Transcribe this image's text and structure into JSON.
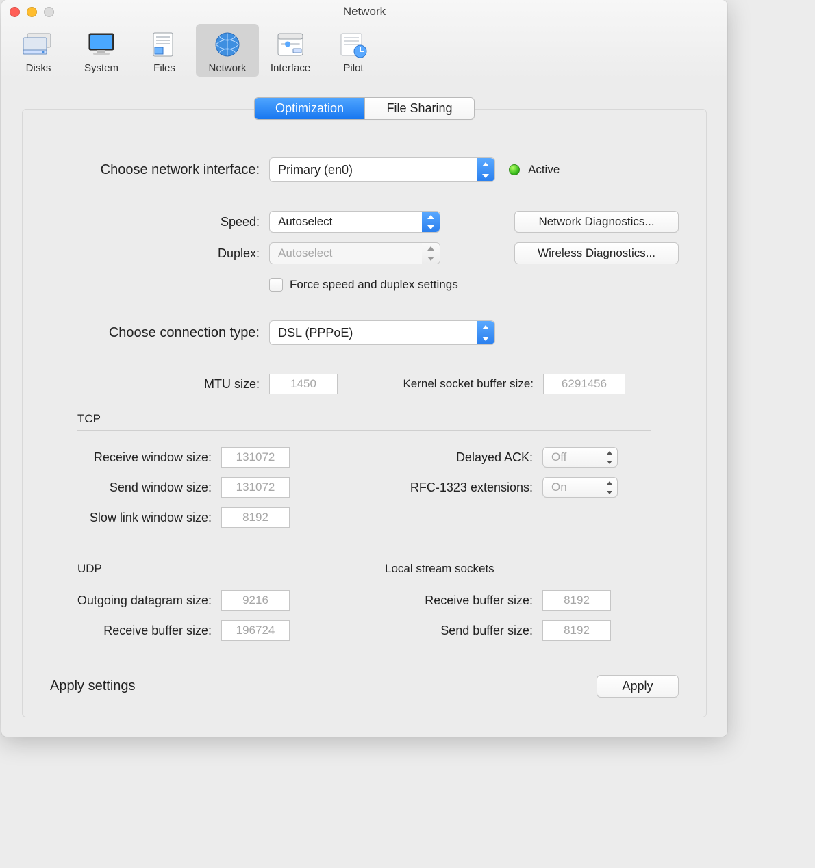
{
  "window": {
    "title": "Network"
  },
  "toolbar": {
    "items": [
      {
        "label": "Disks"
      },
      {
        "label": "System"
      },
      {
        "label": "Files"
      },
      {
        "label": "Network"
      },
      {
        "label": "Interface"
      },
      {
        "label": "Pilot"
      }
    ],
    "selected_index": 3
  },
  "tabs": {
    "items": [
      "Optimization",
      "File Sharing"
    ],
    "selected_index": 0
  },
  "form": {
    "choose_interface_label": "Choose network interface:",
    "interface_value": "Primary (en0)",
    "status_label": "Active",
    "speed_label": "Speed:",
    "speed_value": "Autoselect",
    "duplex_label": "Duplex:",
    "duplex_value": "Autoselect",
    "net_diag_label": "Network Diagnostics...",
    "wifi_diag_label": "Wireless Diagnostics...",
    "force_label": "Force speed and duplex settings",
    "conn_type_label": "Choose connection type:",
    "conn_type_value": "DSL (PPPoE)",
    "mtu_label": "MTU size:",
    "mtu_value": "1450",
    "kbuf_label": "Kernel socket buffer size:",
    "kbuf_value": "6291456",
    "tcp_heading": "TCP",
    "recv_win_label": "Receive window size:",
    "recv_win_value": "131072",
    "send_win_label": "Send window size:",
    "send_win_value": "131072",
    "slow_win_label": "Slow link window size:",
    "slow_win_value": "8192",
    "delayed_ack_label": "Delayed ACK:",
    "delayed_ack_value": "Off",
    "rfc_label": "RFC-1323 extensions:",
    "rfc_value": "On",
    "udp_heading": "UDP",
    "udp_out_label": "Outgoing datagram size:",
    "udp_out_value": "9216",
    "udp_recv_label": "Receive buffer size:",
    "udp_recv_value": "196724",
    "lss_heading": "Local stream sockets",
    "lss_recv_label": "Receive buffer size:",
    "lss_recv_value": "8192",
    "lss_send_label": "Send buffer size:",
    "lss_send_value": "8192",
    "footer_label": "Apply settings",
    "apply_button": "Apply"
  }
}
